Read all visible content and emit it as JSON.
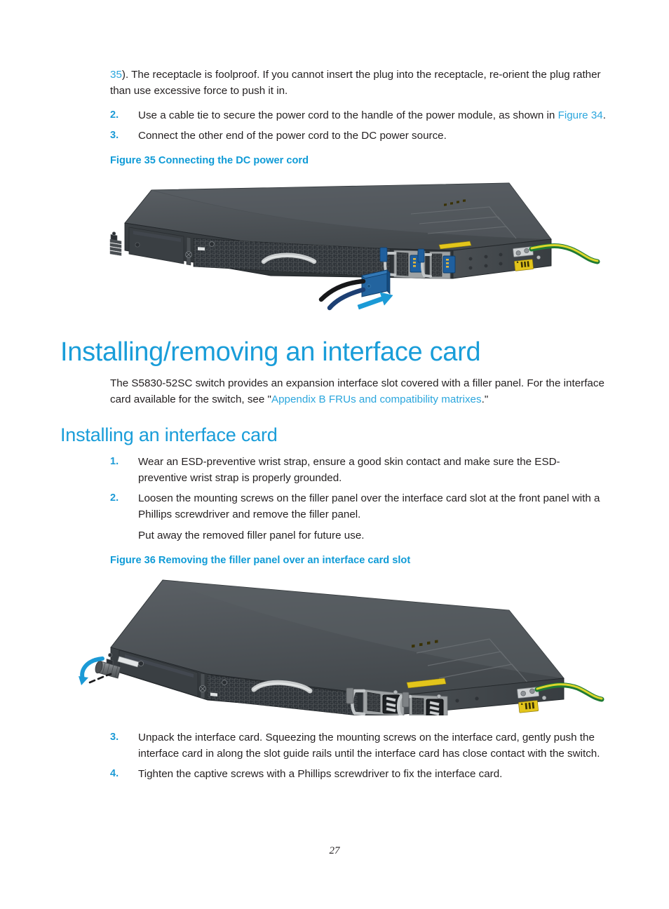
{
  "document": {
    "page_number": "27"
  },
  "intro": {
    "continued_paragraph_prefix": "35",
    "continued_paragraph_rest": "). The receptacle is foolproof. If you cannot insert the plug into the receptacle, re-orient the plug rather than use excessive force to push it in."
  },
  "steps_dc": [
    {
      "num": "2.",
      "text_before": "Use a cable tie to secure the power cord to the handle of the power module, as shown in ",
      "link": "Figure 34",
      "text_after": "."
    },
    {
      "num": "3.",
      "text_before": "Connect the other end of the power cord to the DC power source.",
      "link": "",
      "text_after": ""
    }
  ],
  "figure35": {
    "caption": "Figure 35 Connecting the DC power cord",
    "alt": "Isometric illustration of an S5830-52SC switch rear showing a blue DC power cord plug being inserted into the left power module, with a green-yellow grounding cable attached at the right."
  },
  "section": {
    "h1": "Installing/removing an interface card",
    "body_before_link": "The S5830-52SC switch provides an expansion interface slot covered with a filler panel. For the interface card available for the switch, see \"",
    "body_link": "Appendix B FRUs and compatibility matrixes",
    "body_after_link": ".\"",
    "h2": "Installing an interface card"
  },
  "steps_install": [
    {
      "num": "1.",
      "text": "Wear an ESD-preventive wrist strap, ensure a good skin contact and make sure the ESD-preventive wrist strap is properly grounded.",
      "sub": ""
    },
    {
      "num": "2.",
      "text": "Loosen the mounting screws on the filler panel over the interface card slot at the front panel with a Phillips screwdriver and remove the filler panel.",
      "sub": "Put away the removed filler panel for future use."
    }
  ],
  "figure36": {
    "caption": "Figure 36 Removing the filler panel over an interface card slot",
    "alt": "Isometric illustration of an S5830-52SC switch with a Phillips screwdriver loosening the mounting screw of the filler panel, with a curved blue rotation arrow."
  },
  "steps_install_tail": [
    {
      "num": "3.",
      "text": "Unpack the interface card. Squeezing the mounting screws on the interface card, gently push the interface card in along the slot guide rails until the interface card has close contact with the switch."
    },
    {
      "num": "4.",
      "text": "Tighten the captive screws with a Phillips screwdriver to fix the interface card."
    }
  ],
  "colors": {
    "heading_blue": "#199dd9",
    "caption_blue": "#0f9bd7",
    "link_blue": "#2ba6dd",
    "body_black": "#231f20",
    "chassis_dark": "#3f4448",
    "chassis_top": "#54595d",
    "chassis_face": "#33383c",
    "connector_blue": "#1c5f9e",
    "arrow_blue": "#1b9ad6",
    "ground_green": "#1f7a34",
    "ground_yellow": "#d9d225",
    "label_yellow": "#e3c51b",
    "metal_silver": "#b9bcbe"
  }
}
